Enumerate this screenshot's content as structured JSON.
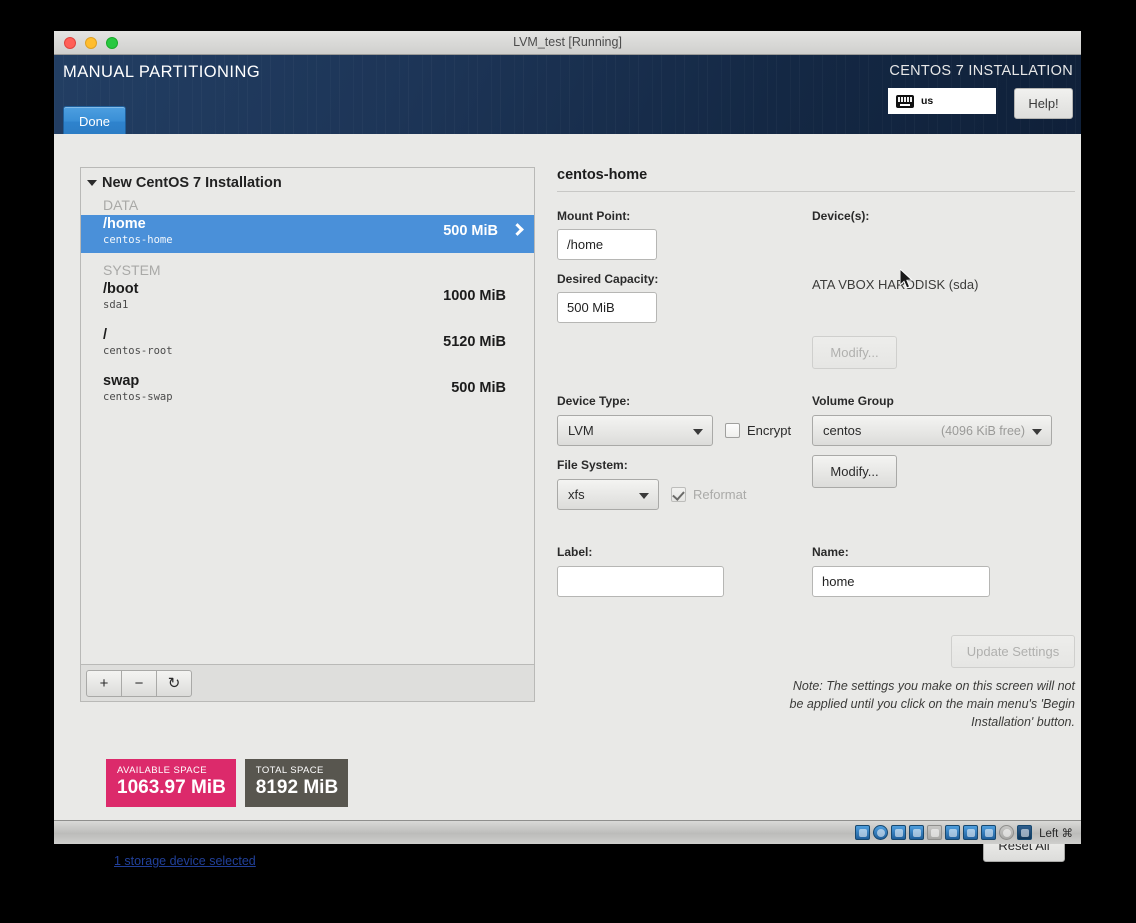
{
  "window": {
    "title": "LVM_test [Running]",
    "traffic_lights": [
      "close-red",
      "minimize-yellow",
      "zoom-green"
    ]
  },
  "header": {
    "title": "MANUAL PARTITIONING",
    "done_label": "Done",
    "product": "CENTOS 7 INSTALLATION",
    "keyboard_layout": "us",
    "keyboard_icon": "keyboard-icon",
    "help_label": "Help!"
  },
  "partitions": {
    "group_label": "New CentOS 7 Installation",
    "sections": [
      {
        "label": "DATA",
        "rows": [
          {
            "mount": "/home",
            "device": "centos-home",
            "size": "500 MiB",
            "selected": true
          }
        ]
      },
      {
        "label": "SYSTEM",
        "rows": [
          {
            "mount": "/boot",
            "device": "sda1",
            "size": "1000 MiB",
            "selected": false
          },
          {
            "mount": "/",
            "device": "centos-root",
            "size": "5120 MiB",
            "selected": false
          },
          {
            "mount": "swap",
            "device": "centos-swap",
            "size": "500 MiB",
            "selected": false
          }
        ]
      }
    ],
    "toolbar": {
      "add_label": "+",
      "remove_label": "−",
      "refresh_label": "↻"
    }
  },
  "space": {
    "available_caption": "AVAILABLE SPACE",
    "available_value": "1063.97 MiB",
    "available_color": "#dc2a6b",
    "total_caption": "TOTAL SPACE",
    "total_value": "8192 MiB",
    "total_color": "#58564f",
    "storage_link": "1 storage device selected"
  },
  "detail": {
    "title": "centos-home",
    "mount_point_label": "Mount Point:",
    "mount_point_value": "/home",
    "desired_capacity_label": "Desired Capacity:",
    "desired_capacity_value": "500 MiB",
    "devices_label": "Device(s):",
    "devices_value": "ATA VBOX HARDDISK (sda)",
    "devices_modify_label": "Modify...",
    "device_type_label": "Device Type:",
    "device_type_value": "LVM",
    "encrypt_label": "Encrypt",
    "encrypt_checked": false,
    "file_system_label": "File System:",
    "file_system_value": "xfs",
    "reformat_label": "Reformat",
    "reformat_checked": true,
    "volume_group_label": "Volume Group",
    "volume_group_value": "centos",
    "volume_group_free": "(4096 KiB free)",
    "volume_group_modify_label": "Modify...",
    "label_label": "Label:",
    "label_value": "",
    "name_label": "Name:",
    "name_value": "home",
    "update_settings_label": "Update Settings",
    "note_text": "Note:  The settings you make on this screen will not be applied until you click on the main menu's 'Begin Installation' button.",
    "reset_all_label": "Reset All"
  },
  "statusbar": {
    "icons": [
      "hard-disk-icon",
      "optical-disk-icon",
      "network-icon",
      "usb-icon",
      "shared-folders-icon",
      "display-icon",
      "remote-display-icon",
      "recording-icon",
      "mouse-icon",
      "host-key-icon"
    ],
    "host_key_text": "Left ⌘"
  },
  "colors": {
    "header_bg": "#1d3557",
    "accent_blue": "#4a90d9",
    "available_pink": "#dc2a6b",
    "total_gray": "#58564f",
    "link_blue": "#21409a"
  }
}
